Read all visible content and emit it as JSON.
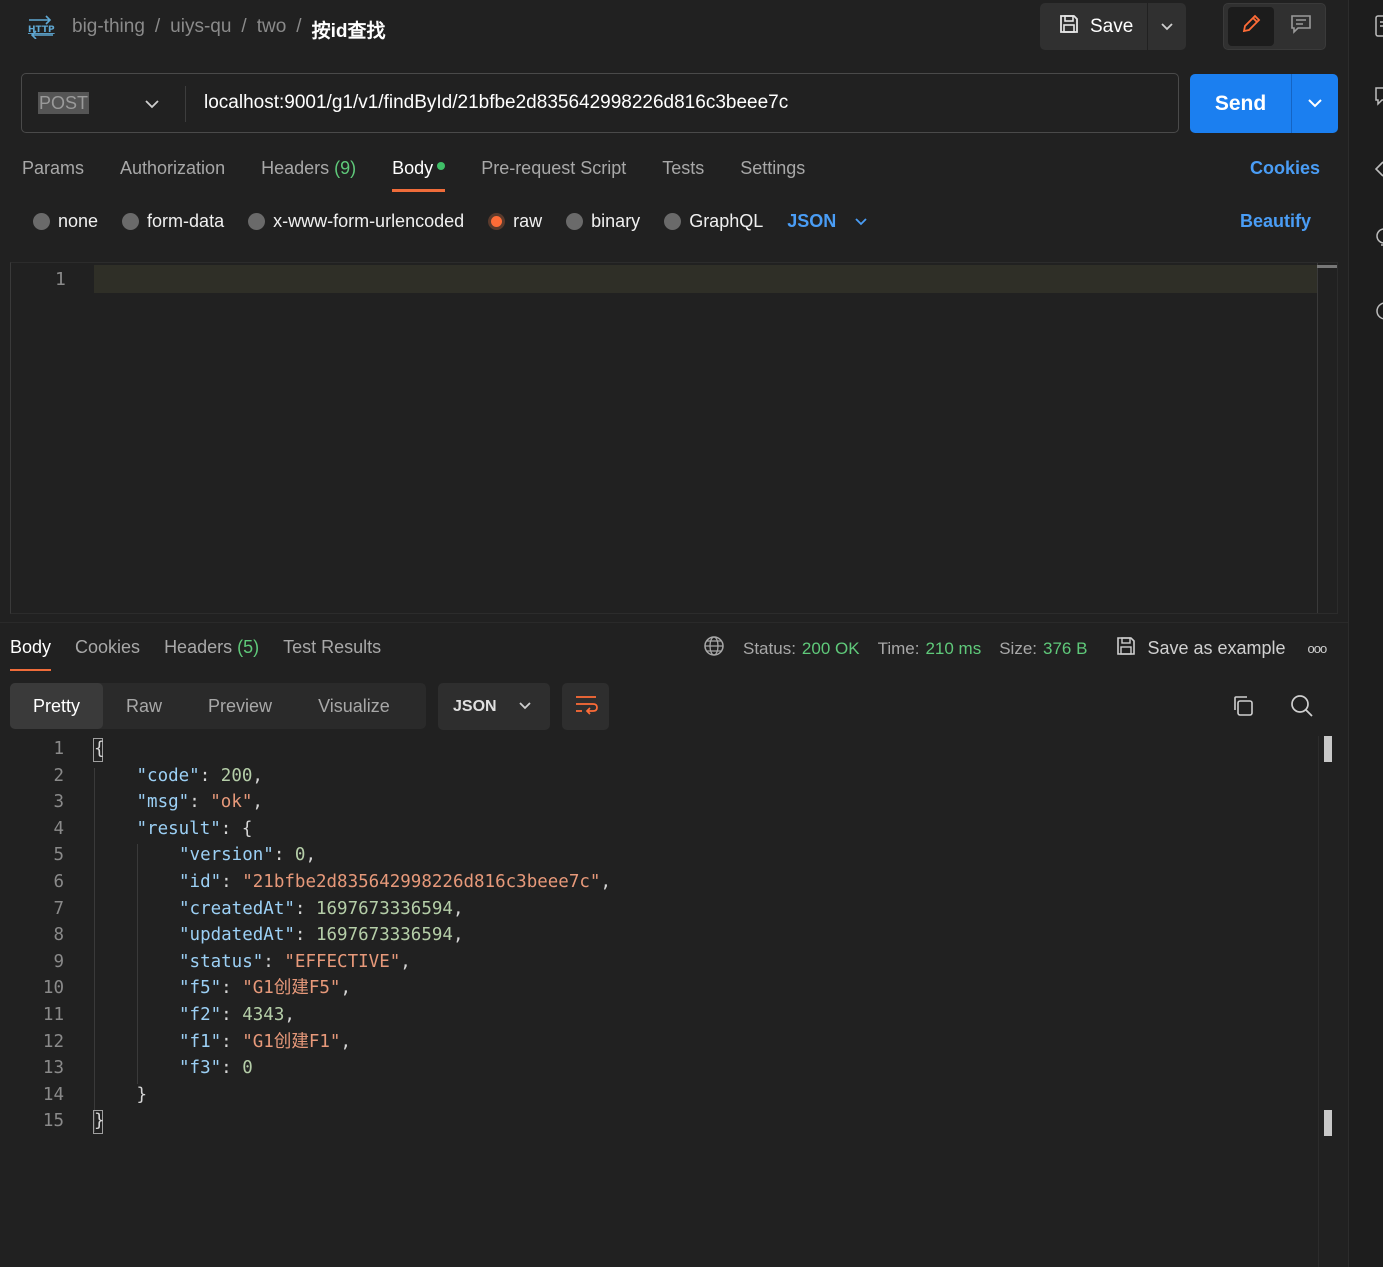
{
  "breadcrumb": {
    "protocol_icon": "http-icon",
    "items": [
      "big-thing",
      "uiys-qu",
      "two"
    ],
    "separator": "/",
    "current": "按id查找"
  },
  "toolbar": {
    "save_label": "Save",
    "save_icon": "save-icon",
    "edit_icon": "pencil-icon",
    "comment_icon": "comment-icon"
  },
  "request": {
    "method": "POST",
    "url": "localhost:9001/g1/v1/findById/21bfbe2d835642998226d816c3beee7c",
    "send_label": "Send"
  },
  "request_tabs": [
    {
      "label": "Params",
      "count": ""
    },
    {
      "label": "Authorization",
      "count": ""
    },
    {
      "label": "Headers",
      "count": "(9)"
    },
    {
      "label": "Body",
      "count": ""
    },
    {
      "label": "Pre-request Script",
      "count": ""
    },
    {
      "label": "Tests",
      "count": ""
    },
    {
      "label": "Settings",
      "count": ""
    }
  ],
  "active_request_tab": "Body",
  "cookies_link": "Cookies",
  "body_types": [
    "none",
    "form-data",
    "x-www-form-urlencoded",
    "raw",
    "binary",
    "GraphQL"
  ],
  "selected_body_type": "raw",
  "raw_format": "JSON",
  "beautify_label": "Beautify",
  "request_editor": {
    "line_numbers": [
      "1"
    ],
    "content": ""
  },
  "response_tabs": [
    {
      "label": "Body",
      "count": ""
    },
    {
      "label": "Cookies",
      "count": ""
    },
    {
      "label": "Headers",
      "count": "(5)"
    },
    {
      "label": "Test Results",
      "count": ""
    }
  ],
  "active_response_tab": "Body",
  "response_meta": {
    "status_label": "Status:",
    "status_value": "200 OK",
    "time_label": "Time:",
    "time_value": "210 ms",
    "size_label": "Size:",
    "size_value": "376 B",
    "save_example_label": "Save as example",
    "more_label": "ooo"
  },
  "view_modes": [
    "Pretty",
    "Raw",
    "Preview",
    "Visualize"
  ],
  "active_view_mode": "Pretty",
  "response_format": "JSON",
  "response_lines": [
    {
      "n": "1",
      "indent": 0,
      "tokens": [
        [
          "p",
          "{"
        ]
      ]
    },
    {
      "n": "2",
      "indent": 1,
      "tokens": [
        [
          "k",
          "\"code\""
        ],
        [
          "p",
          ": "
        ],
        [
          "n",
          "200"
        ],
        [
          "p",
          ","
        ]
      ]
    },
    {
      "n": "3",
      "indent": 1,
      "tokens": [
        [
          "k",
          "\"msg\""
        ],
        [
          "p",
          ": "
        ],
        [
          "s",
          "\"ok\""
        ],
        [
          "p",
          ","
        ]
      ]
    },
    {
      "n": "4",
      "indent": 1,
      "tokens": [
        [
          "k",
          "\"result\""
        ],
        [
          "p",
          ": {"
        ]
      ]
    },
    {
      "n": "5",
      "indent": 2,
      "tokens": [
        [
          "k",
          "\"version\""
        ],
        [
          "p",
          ": "
        ],
        [
          "n",
          "0"
        ],
        [
          "p",
          ","
        ]
      ]
    },
    {
      "n": "6",
      "indent": 2,
      "tokens": [
        [
          "k",
          "\"id\""
        ],
        [
          "p",
          ": "
        ],
        [
          "s",
          "\"21bfbe2d835642998226d816c3beee7c\""
        ],
        [
          "p",
          ","
        ]
      ]
    },
    {
      "n": "7",
      "indent": 2,
      "tokens": [
        [
          "k",
          "\"createdAt\""
        ],
        [
          "p",
          ": "
        ],
        [
          "n",
          "1697673336594"
        ],
        [
          "p",
          ","
        ]
      ]
    },
    {
      "n": "8",
      "indent": 2,
      "tokens": [
        [
          "k",
          "\"updatedAt\""
        ],
        [
          "p",
          ": "
        ],
        [
          "n",
          "1697673336594"
        ],
        [
          "p",
          ","
        ]
      ]
    },
    {
      "n": "9",
      "indent": 2,
      "tokens": [
        [
          "k",
          "\"status\""
        ],
        [
          "p",
          ": "
        ],
        [
          "s",
          "\"EFFECTIVE\""
        ],
        [
          "p",
          ","
        ]
      ]
    },
    {
      "n": "10",
      "indent": 2,
      "tokens": [
        [
          "k",
          "\"f5\""
        ],
        [
          "p",
          ": "
        ],
        [
          "s",
          "\"G1创建F5\""
        ],
        [
          "p",
          ","
        ]
      ]
    },
    {
      "n": "11",
      "indent": 2,
      "tokens": [
        [
          "k",
          "\"f2\""
        ],
        [
          "p",
          ": "
        ],
        [
          "n",
          "4343"
        ],
        [
          "p",
          ","
        ]
      ]
    },
    {
      "n": "12",
      "indent": 2,
      "tokens": [
        [
          "k",
          "\"f1\""
        ],
        [
          "p",
          ": "
        ],
        [
          "s",
          "\"G1创建F1\""
        ],
        [
          "p",
          ","
        ]
      ]
    },
    {
      "n": "13",
      "indent": 2,
      "tokens": [
        [
          "k",
          "\"f3\""
        ],
        [
          "p",
          ": "
        ],
        [
          "n",
          "0"
        ]
      ]
    },
    {
      "n": "14",
      "indent": 1,
      "tokens": [
        [
          "p",
          "}"
        ]
      ]
    },
    {
      "n": "15",
      "indent": 0,
      "tokens": [
        [
          "p",
          "}"
        ]
      ]
    }
  ],
  "colors": {
    "accent_orange": "#ff6c37",
    "send_blue": "#1b7ff0",
    "link_blue": "#4a9df5",
    "status_green": "#5fc97a",
    "json_key": "#9cd0f5",
    "json_string": "#e7997a",
    "json_number": "#b5cea8"
  }
}
